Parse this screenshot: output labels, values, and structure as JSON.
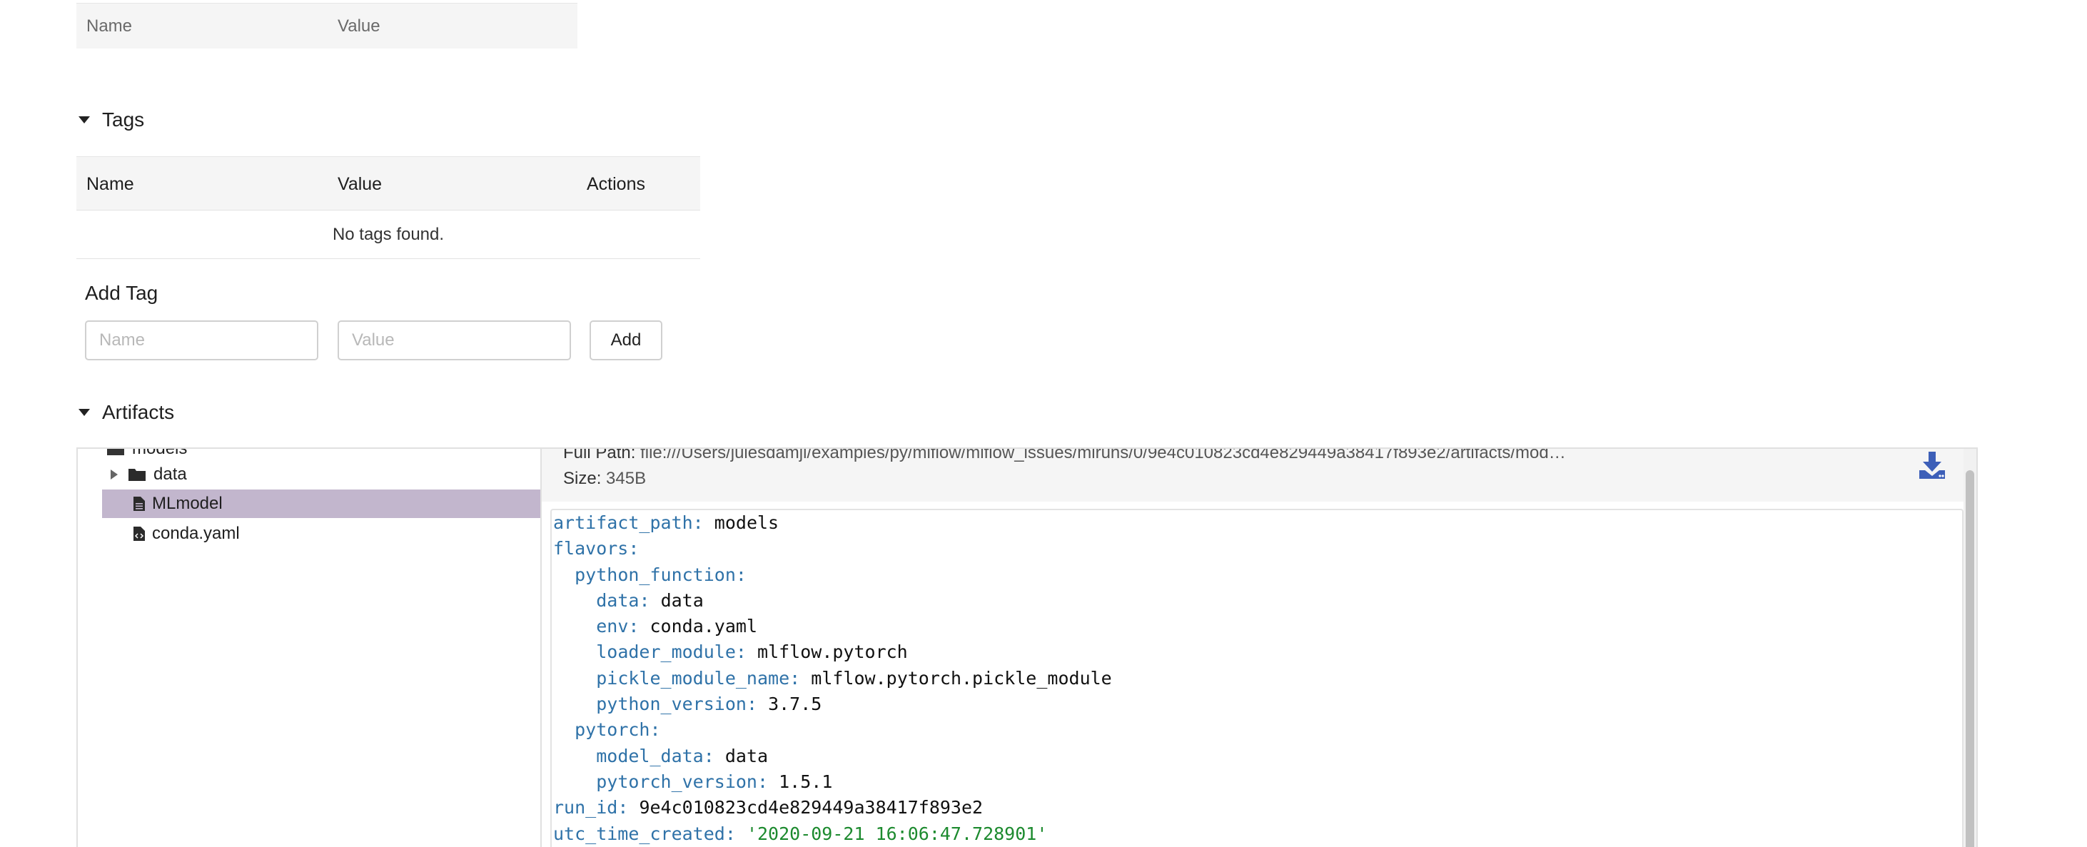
{
  "params": {
    "columns": [
      "Name",
      "Value"
    ]
  },
  "tags": {
    "header": "Tags",
    "columns": [
      "Name",
      "Value",
      "Actions"
    ],
    "empty_text": "No tags found."
  },
  "add_tag": {
    "title": "Add Tag",
    "name_placeholder": "Name",
    "value_placeholder": "Value",
    "add_label": "Add"
  },
  "artifacts": {
    "header": "Artifacts",
    "tree": {
      "cut_item": "models",
      "items": [
        {
          "label": "data",
          "type": "folder",
          "expandable": true
        },
        {
          "label": "MLmodel",
          "type": "file",
          "selected": true
        },
        {
          "label": "conda.yaml",
          "type": "code-file"
        }
      ]
    },
    "file_info": {
      "full_path_label": "Full Path:",
      "full_path_value": "file:///Users/julesdamji/examples/py/mlflow/mlflow_issues/mlruns/0/9e4c010823cd4e829449a38417f893e2/artifacts/mod…",
      "size_label": "Size:",
      "size_value": "345B"
    },
    "code_lines": [
      {
        "key": "artifact_path",
        "indent": 0,
        "value": "models",
        "value_type": "plain"
      },
      {
        "key": "flavors",
        "indent": 0,
        "value": "",
        "value_type": "plain"
      },
      {
        "key": "python_function",
        "indent": 1,
        "value": "",
        "value_type": "plain"
      },
      {
        "key": "data",
        "indent": 2,
        "value": "data",
        "value_type": "plain"
      },
      {
        "key": "env",
        "indent": 2,
        "value": "conda.yaml",
        "value_type": "plain"
      },
      {
        "key": "loader_module",
        "indent": 2,
        "value": "mlflow.pytorch",
        "value_type": "plain"
      },
      {
        "key": "pickle_module_name",
        "indent": 2,
        "value": "mlflow.pytorch.pickle_module",
        "value_type": "plain"
      },
      {
        "key": "python_version",
        "indent": 2,
        "value": "3.7.5",
        "value_type": "plain"
      },
      {
        "key": "pytorch",
        "indent": 1,
        "value": "",
        "value_type": "plain"
      },
      {
        "key": "model_data",
        "indent": 2,
        "value": "data",
        "value_type": "plain"
      },
      {
        "key": "pytorch_version",
        "indent": 2,
        "value": "1.5.1",
        "value_type": "plain"
      },
      {
        "key": "run_id",
        "indent": 0,
        "value": "9e4c010823cd4e829449a38417f893e2",
        "value_type": "plain"
      },
      {
        "key": "utc_time_created",
        "indent": 0,
        "value": "'2020-09-21 16:06:47.728901'",
        "value_type": "string"
      }
    ]
  },
  "colors": {
    "selected_row": "#c2b6cd",
    "yaml_key": "#2f72a8",
    "yaml_string": "#1c8a2e",
    "download_icon": "#3d5fb8"
  },
  "icons": {
    "caret_down": "caret-down-icon",
    "caret_right": "caret-right-icon",
    "folder": "folder-icon",
    "file": "file-icon",
    "code_file": "code-file-icon",
    "download": "download-icon"
  }
}
